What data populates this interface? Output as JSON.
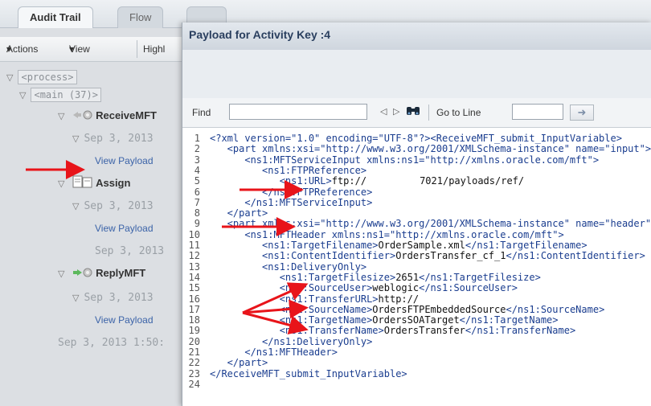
{
  "tabs": [
    {
      "label": "Audit Trail"
    },
    {
      "label": "Flow"
    }
  ],
  "toolbar": {
    "actions": "Actions",
    "view": "View",
    "highlight": "Highl"
  },
  "tree": {
    "process": "<process>",
    "main": "<main (37)>",
    "receive": "ReceiveMFT",
    "assign": "Assign",
    "reply": "ReplyMFT",
    "date": "Sep 3, 2013",
    "date_last": "Sep 3, 2013 1:50:",
    "view_payload": "View Payload"
  },
  "dialog": {
    "title": "Payload for Activity Key :4",
    "find_label": "Find",
    "find_value": "",
    "goto_label": "Go to Line",
    "goto_value": ""
  },
  "code_lines": [
    {
      "n": "1",
      "tag": "<?xml version=\"1.0\" encoding=\"UTF-8\"?><ReceiveMFT_submit_InputVariable>",
      "txt": ""
    },
    {
      "n": "2",
      "tag": "   <part xmlns:xsi=\"http://www.w3.org/2001/XMLSchema-instance\" name=\"input\">",
      "txt": ""
    },
    {
      "n": "3",
      "tag": "      <ns1:MFTServiceInput xmlns:ns1=\"http://xmlns.oracle.com/mft\">",
      "txt": ""
    },
    {
      "n": "4",
      "tag": "         <ns1:FTPReference>",
      "txt": ""
    },
    {
      "n": "5",
      "tag": "            <ns1:URL>",
      "txt": "ftp://",
      "after": "7021/payloads/ref/"
    },
    {
      "n": "6",
      "tag": "         </ns1:FTPReference>",
      "txt": ""
    },
    {
      "n": "7",
      "tag": "      </ns1:MFTServiceInput>",
      "txt": ""
    },
    {
      "n": "8",
      "tag": "   </part>",
      "txt": ""
    },
    {
      "n": "9",
      "tag": "   <part xmlns:xsi=\"http://www.w3.org/2001/XMLSchema-instance\" name=\"header\">",
      "txt": ""
    },
    {
      "n": "10",
      "tag": "      <ns1:MFTHeader xmlns:ns1=\"http://xmlns.oracle.com/mft\">",
      "txt": ""
    },
    {
      "n": "11",
      "tag": "         <ns1:TargetFilename>",
      "txt": "OrderSample.xml",
      "close": "</ns1:TargetFilename>"
    },
    {
      "n": "12",
      "tag": "         <ns1:ContentIdentifier>",
      "txt": "OrdersTransfer_cf_1",
      "close": "</ns1:ContentIdentifier>"
    },
    {
      "n": "13",
      "tag": "         <ns1:DeliveryOnly>",
      "txt": ""
    },
    {
      "n": "14",
      "tag": "            <ns1:TargetFilesize>",
      "txt": "2651",
      "close": "</ns1:TargetFilesize>"
    },
    {
      "n": "15",
      "tag": "            <ns1:SourceUser>",
      "txt": "weblogic",
      "close": "</ns1:SourceUser>"
    },
    {
      "n": "16",
      "tag": "            <ns1:TransferURL>",
      "txt": "http://",
      "close": ""
    },
    {
      "n": "17",
      "tag": "            <ns1:SourceName>",
      "txt": "OrdersFTPEmbeddedSource",
      "close": "</ns1:SourceName>"
    },
    {
      "n": "18",
      "tag": "            <ns1:TargetName>",
      "txt": "OrdersSOATarget",
      "close": "</ns1:TargetName>"
    },
    {
      "n": "19",
      "tag": "            <ns1:TransferName>",
      "txt": "OrdersTransfer",
      "close": "</ns1:TransferName>"
    },
    {
      "n": "20",
      "tag": "         </ns1:DeliveryOnly>",
      "txt": ""
    },
    {
      "n": "21",
      "tag": "      </ns1:MFTHeader>",
      "txt": ""
    },
    {
      "n": "22",
      "tag": "   </part>",
      "txt": ""
    },
    {
      "n": "23",
      "tag": "</ReceiveMFT_submit_InputVariable>",
      "txt": ""
    },
    {
      "n": "24",
      "tag": "",
      "txt": ""
    }
  ],
  "colors": {
    "tag": "#1a3d8f",
    "arrow": "#e8141a",
    "link": "#3b63a8"
  }
}
